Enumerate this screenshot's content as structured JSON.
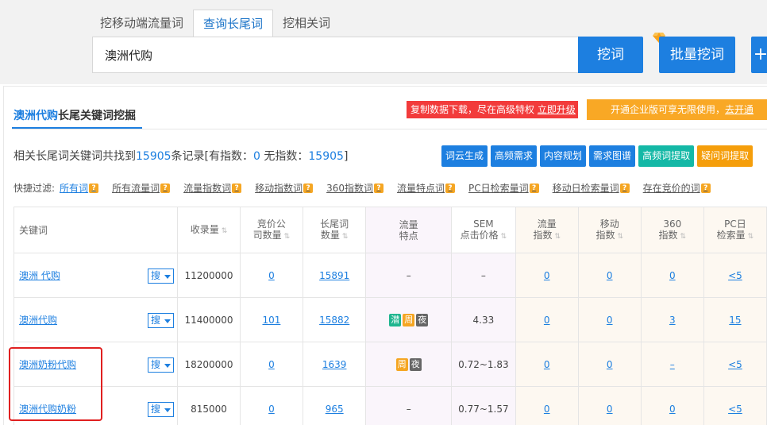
{
  "tabs": [
    {
      "label": "挖移动端流量词"
    },
    {
      "label": "查询长尾词"
    },
    {
      "label": "挖相关词"
    }
  ],
  "search": {
    "value": "澳洲代购",
    "dig_label": "挖词",
    "batch_label": "批量挖词",
    "plus_label": "+"
  },
  "title": {
    "keyword": "澳洲代购",
    "rest": "长尾关键词挖掘"
  },
  "upgrade": {
    "text": "复制数据下载，尽在高级特权",
    "link": "立即升级"
  },
  "enterprise": {
    "text": "开通企业版可享无限使用，",
    "link": "去开通"
  },
  "summary": {
    "prefix": "相关长尾词关键词共找到",
    "total": "15905",
    "mid": "条记录[有指数：",
    "with_index": "0",
    "mid2": "无指数：",
    "without_index": "15905",
    "suffix": "]"
  },
  "tools": [
    {
      "label": "词云生成",
      "color": "#1d7fe0"
    },
    {
      "label": "高频需求",
      "color": "#1d7fe0"
    },
    {
      "label": "内容规划",
      "color": "#1d7fe0"
    },
    {
      "label": "需求图谱",
      "color": "#1d7fe0"
    },
    {
      "label": "高频词提取",
      "color": "#14b8a6"
    },
    {
      "label": "疑问词提取",
      "color": "#f59e0b"
    }
  ],
  "filters": {
    "label": "快捷过滤:",
    "items": [
      "所有词",
      "所有流量词",
      "流量指数词",
      "移动指数词",
      "360指数词",
      "流量特点词",
      "PC日检索量词",
      "移动日检索量词",
      "存在竞价的词"
    ]
  },
  "table": {
    "headers": [
      "关键词",
      "收录量",
      "竞价公\n司数量",
      "长尾词\n数量",
      "流量\n特点",
      "SEM\n点击价格",
      "流量\n指数",
      "移动\n指数",
      "360\n指数",
      "PC日\n检索量"
    ],
    "search_label": "搜",
    "rows": [
      {
        "kw": "澳洲 代购",
        "count": "11200000",
        "bid": "0",
        "longtail": "15891",
        "traits": [],
        "traits_empty": "–",
        "sem": "–",
        "flow": "0",
        "mobile": "0",
        "i360": "0",
        "pc": "<5"
      },
      {
        "kw": "澳洲代购",
        "count": "11400000",
        "bid": "101",
        "longtail": "15882",
        "traits": [
          {
            "t": "潜",
            "c": "#1fb58f"
          },
          {
            "t": "周",
            "c": "#f5a623"
          },
          {
            "t": "夜",
            "c": "#666666"
          }
        ],
        "traits_empty": "",
        "sem": "4.33",
        "flow": "0",
        "mobile": "0",
        "i360": "3",
        "pc": "15"
      },
      {
        "kw": "澳洲奶粉代购",
        "count": "18200000",
        "bid": "0",
        "longtail": "1639",
        "traits": [
          {
            "t": "周",
            "c": "#f5a623"
          },
          {
            "t": "夜",
            "c": "#666666"
          }
        ],
        "traits_empty": "",
        "sem": "0.72~1.83",
        "flow": "0",
        "mobile": "0",
        "i360": "–",
        "pc": "<5"
      },
      {
        "kw": "澳洲代购奶粉",
        "count": "815000",
        "bid": "0",
        "longtail": "965",
        "traits": [],
        "traits_empty": "–",
        "sem": "0.77~1.57",
        "flow": "0",
        "mobile": "0",
        "i360": "0",
        "pc": "<5"
      }
    ]
  }
}
